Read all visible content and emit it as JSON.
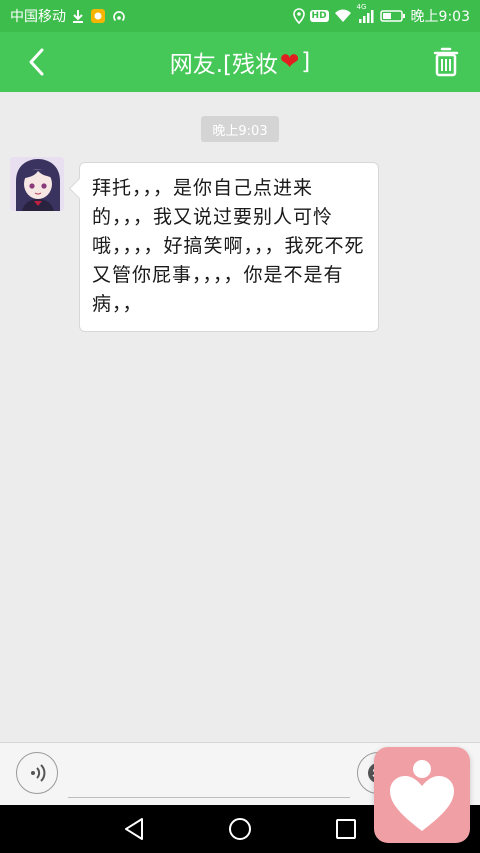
{
  "status_bar": {
    "carrier": "中国移动",
    "network_badge": "HD",
    "signal_label": "4G",
    "time_label": "晚上9:03",
    "icons": [
      "download-icon",
      "app-icon",
      "hotspot-icon",
      "location-icon",
      "hd-icon",
      "wifi-icon",
      "signal-icon",
      "battery-icon"
    ]
  },
  "header": {
    "title_prefix": "网友.[残妆",
    "title_heart": "❤",
    "title_suffix": "]",
    "back_icon": "back-chevron-icon",
    "delete_icon": "trash-icon"
  },
  "chat": {
    "timestamp": "晚上9:03",
    "messages": [
      {
        "sender": "friend",
        "text": "拜托，，，是你自己点进来的，，，我又说过要别人可怜哦，，，，好搞笑啊，，，我死不死又管你屁事，，，，你是不是有病，，"
      }
    ]
  },
  "input_bar": {
    "placeholder": "",
    "value": ""
  },
  "colors": {
    "status_bar": "#3dbd4c",
    "app_bar": "#45c857",
    "chat_bg": "#ececec",
    "floating_button": "#f0a0a5"
  }
}
